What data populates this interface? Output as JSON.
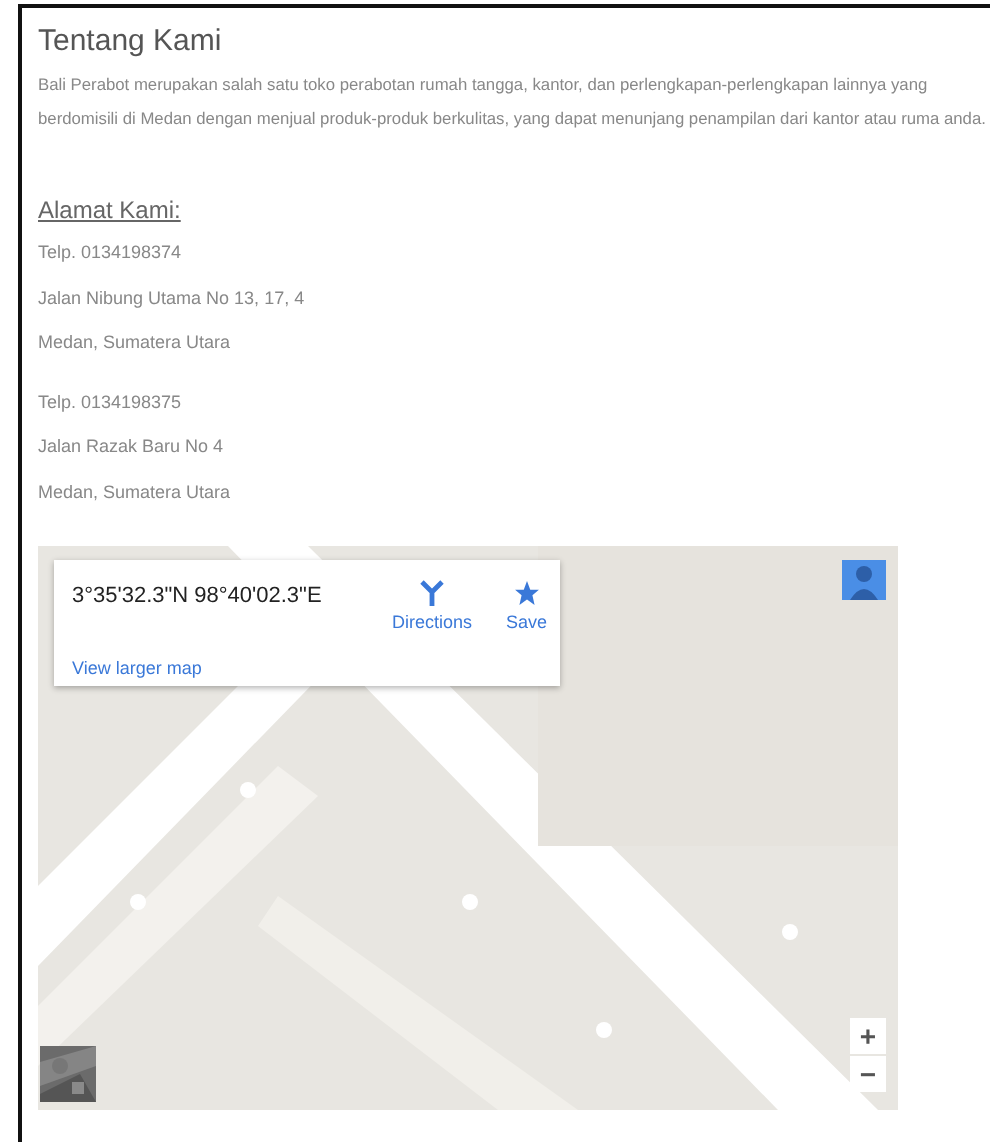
{
  "heading": "Tentang Kami",
  "intro": "Bali Perabot merupakan salah satu toko perabotan rumah tangga, kantor, dan perlengkapan-perlengkapan lainnya yang berdomisili di Medan dengan menjual produk-produk berkulitas, yang dapat menunjang penampilan dari kantor atau ruma anda.",
  "address_heading": "Alamat Kami:",
  "addresses": [
    {
      "lines": [
        "Telp. 0134198374",
        "Jalan Nibung Utama No 13, 17, 4",
        "Medan, Sumatera Utara"
      ]
    },
    {
      "lines": [
        "Telp. 0134198375",
        "Jalan Razak Baru No 4",
        "Medan, Sumatera Utara"
      ]
    }
  ],
  "map": {
    "kind": "picture",
    "card": {
      "coordinates": "3°35'32.3\"N 98°40'02.3\"E",
      "link": "View larger map",
      "actions": [
        {
          "label": "Directions",
          "kind": "directions"
        },
        {
          "label": "Save",
          "kind": "save"
        }
      ]
    },
    "zoom": [
      "+",
      "−"
    ]
  }
}
